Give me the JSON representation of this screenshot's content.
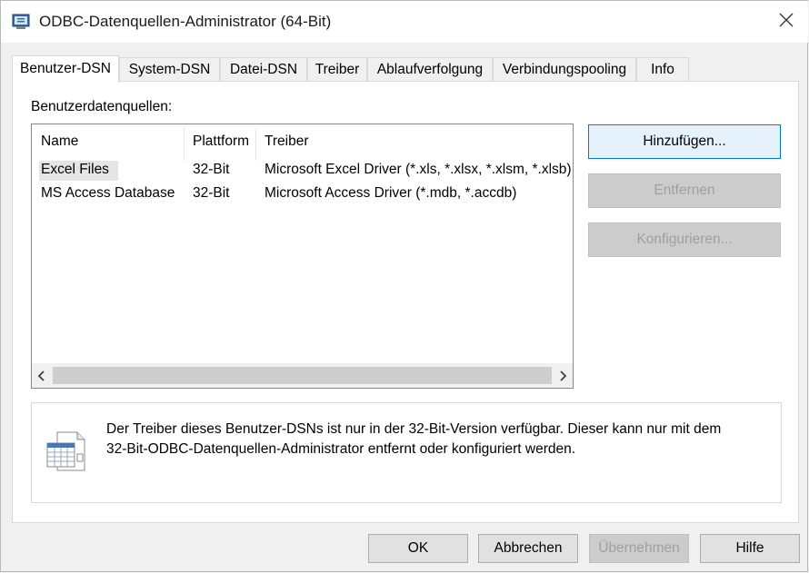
{
  "window": {
    "title": "ODBC-Datenquellen-Administrator (64-Bit)"
  },
  "tabs": [
    {
      "label": "Benutzer-DSN",
      "active": true
    },
    {
      "label": "System-DSN"
    },
    {
      "label": "Datei-DSN"
    },
    {
      "label": "Treiber"
    },
    {
      "label": "Ablaufverfolgung"
    },
    {
      "label": "Verbindungspooling"
    },
    {
      "label": "Info"
    }
  ],
  "panel": {
    "section_label": "Benutzerdatenquellen:",
    "columns": [
      "Name",
      "Plattform",
      "Treiber"
    ],
    "rows": [
      {
        "name": "Excel Files",
        "platform": "32-Bit",
        "driver": "Microsoft Excel Driver (*.xls, *.xlsx, *.xlsm, *.xlsb)"
      },
      {
        "name": "MS Access Database",
        "platform": "32-Bit",
        "driver": "Microsoft Access Driver (*.mdb, *.accdb)"
      }
    ],
    "buttons": {
      "add": "Hinzufügen...",
      "remove": "Entfernen",
      "configure": "Konfigurieren..."
    },
    "info_text_line1": "Der Treiber dieses Benutzer-DSNs ist nur in der 32-Bit-Version verfügbar. Dieser kann nur mit dem",
    "info_text_line2": "32-Bit-ODBC-Datenquellen-Administrator entfernt oder konfiguriert werden."
  },
  "footer": {
    "ok": "OK",
    "cancel": "Abbrechen",
    "apply": "Übernehmen",
    "help": "Hilfe"
  },
  "icons": {
    "app": "odbc-admin-icon",
    "close": "close-icon",
    "info": "data-table-icon",
    "scroll_left": "chevron-left-icon",
    "scroll_right": "chevron-right-icon"
  },
  "colors": {
    "accent": "#0078d7",
    "disabled_text": "#a0a0a0"
  }
}
